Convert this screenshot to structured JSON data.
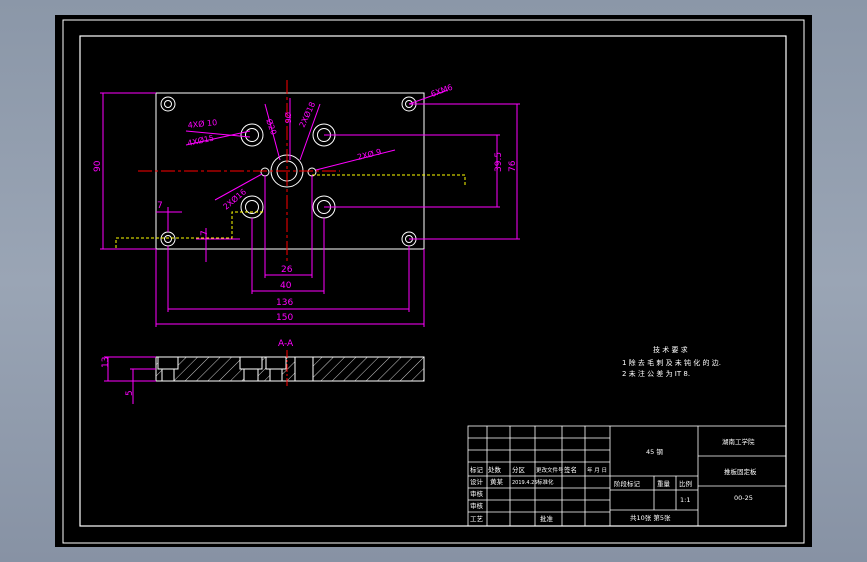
{
  "colors": {
    "background": "#000000",
    "frame": "#ffffff",
    "dimension": "#ff00ff",
    "centerline": "#ff0000",
    "hidden_line": "#ffff00",
    "viewport": "#9aa5b5"
  },
  "dimensions": {
    "height_90": "90",
    "height_76": "76",
    "height_39_5": "39.5",
    "offset_7_left": "7",
    "offset_7_bottom": "7",
    "width_26": "26",
    "width_40": "40",
    "width_136": "136",
    "width_150": "150",
    "thickness_13": "13",
    "depth_5": "5"
  },
  "callouts": {
    "holes_4x10": "4XØ 10",
    "holes_4x15": "4XØ15",
    "holes_2x16": "2XØ16",
    "holes_2x9": "2XØ 9",
    "hole_d20": "Ø20",
    "hole_d6": "Ø6",
    "holes_2xd18": "2XØ18",
    "holes_6xm6": "6XM6"
  },
  "section_label": "A-A",
  "tech_requirements": {
    "title": "技 术 要 求",
    "line1": "1 除 去 毛 刺 及 未 钝 化 的 边.",
    "line2": "2 未 注 公 差 为 IT 8."
  },
  "title_block": {
    "material": "45 钢",
    "company": "湖南工学院",
    "part_name": "推板固定板",
    "drawing_no": "00-25",
    "scale": "1:1",
    "sheet_info": "共10张 第5张",
    "rev_headers": [
      "标记",
      "处数",
      "分区",
      "更改文件号",
      "签名",
      "年 月 日"
    ],
    "design_row": [
      "设计",
      "黄某",
      "2019.4.25",
      "标准化"
    ],
    "stage_headers": [
      "阶段标记",
      "重量",
      "比例"
    ],
    "left_labels": [
      "审核",
      "审核",
      "工艺"
    ],
    "approve_label": "批准"
  }
}
